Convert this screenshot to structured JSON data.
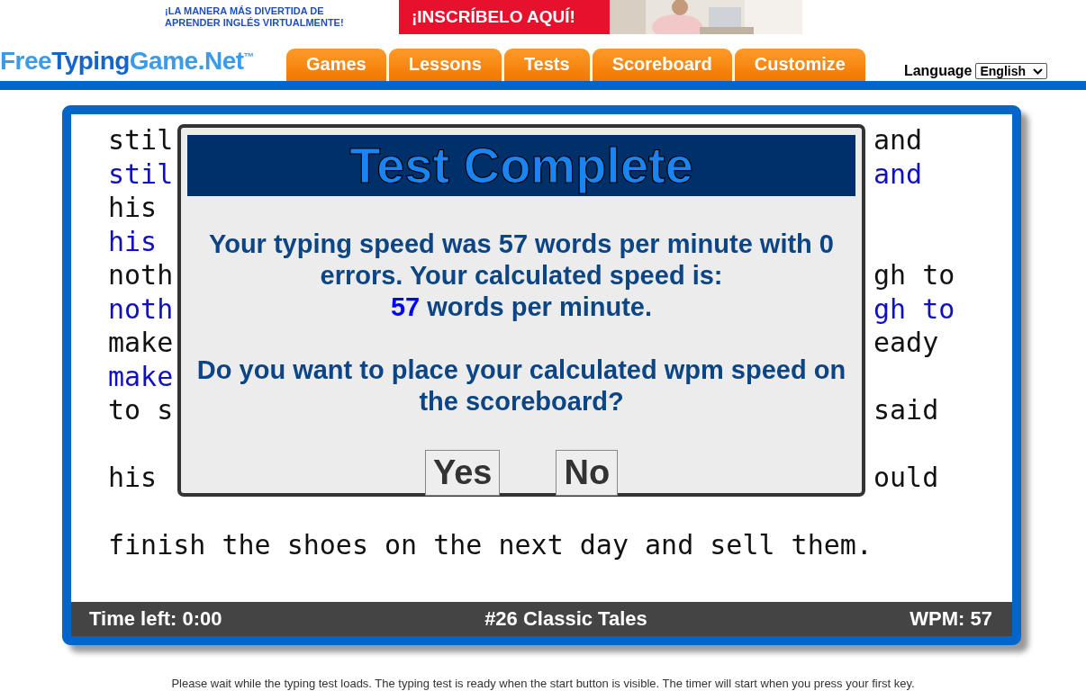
{
  "ad": {
    "tagline_lines": [
      "¡LA MANERA MÁS DIVERTIDA DE",
      "APRENDER INGLÉS VIRTUALMENTE!"
    ],
    "button": "¡INSCRÍBELO AQUÍ!",
    "photo": {
      "kind": "picture"
    }
  },
  "logo": {
    "parts": [
      "Free",
      "Typing",
      "Game.Net"
    ],
    "mark": "™"
  },
  "nav": [
    {
      "label": "Games"
    },
    {
      "label": "Lessons"
    },
    {
      "label": "Tests"
    },
    {
      "label": "Scoreboard"
    },
    {
      "label": "Customize"
    }
  ],
  "language": {
    "label": "Language",
    "value": "English"
  },
  "typing_lines": [
    {
      "kind": "text",
      "left": "stil",
      "right": "and",
      "typed": false
    },
    {
      "kind": "text",
      "left": "stil",
      "right": "and",
      "typed": true
    },
    {
      "kind": "text",
      "left": "his",
      "typed": false
    },
    {
      "kind": "text",
      "left": "his",
      "typed": true
    },
    {
      "kind": "text",
      "left": "noth",
      "right": "gh to",
      "typed": false
    },
    {
      "kind": "text",
      "left": "noth",
      "right": "gh to",
      "typed": true
    },
    {
      "kind": "text",
      "left": "make",
      "right": "eady",
      "typed": false
    },
    {
      "kind": "text",
      "left": "make",
      "typed": true
    },
    {
      "kind": "text",
      "left": "to s",
      "right": "said",
      "typed": false
    },
    {
      "kind": "blank"
    },
    {
      "kind": "text",
      "left": "his",
      "right": "ould",
      "typed": false
    },
    {
      "kind": "blank"
    },
    {
      "kind": "text",
      "left": "finish the shoes on the next day and sell them.",
      "typed": false
    }
  ],
  "status_bar": {
    "time_left": "Time left: 0:00",
    "test_name": "#26 Classic Tales",
    "wpm": "WPM: 57"
  },
  "dialog": {
    "title": "Test Complete",
    "message": "Your typing speed was 57 words per minute with 0 errors. Your calculated speed is:",
    "calculated_value": "57",
    "calculated_unit": "words per minute.",
    "question": "Do you want to place your calculated wpm speed on the scoreboard?",
    "buttons": [
      "Yes",
      "No"
    ]
  },
  "footer_note": "Please wait while the typing test loads. The typing test is ready when the start button is visible. The timer will start when you press your first key."
}
